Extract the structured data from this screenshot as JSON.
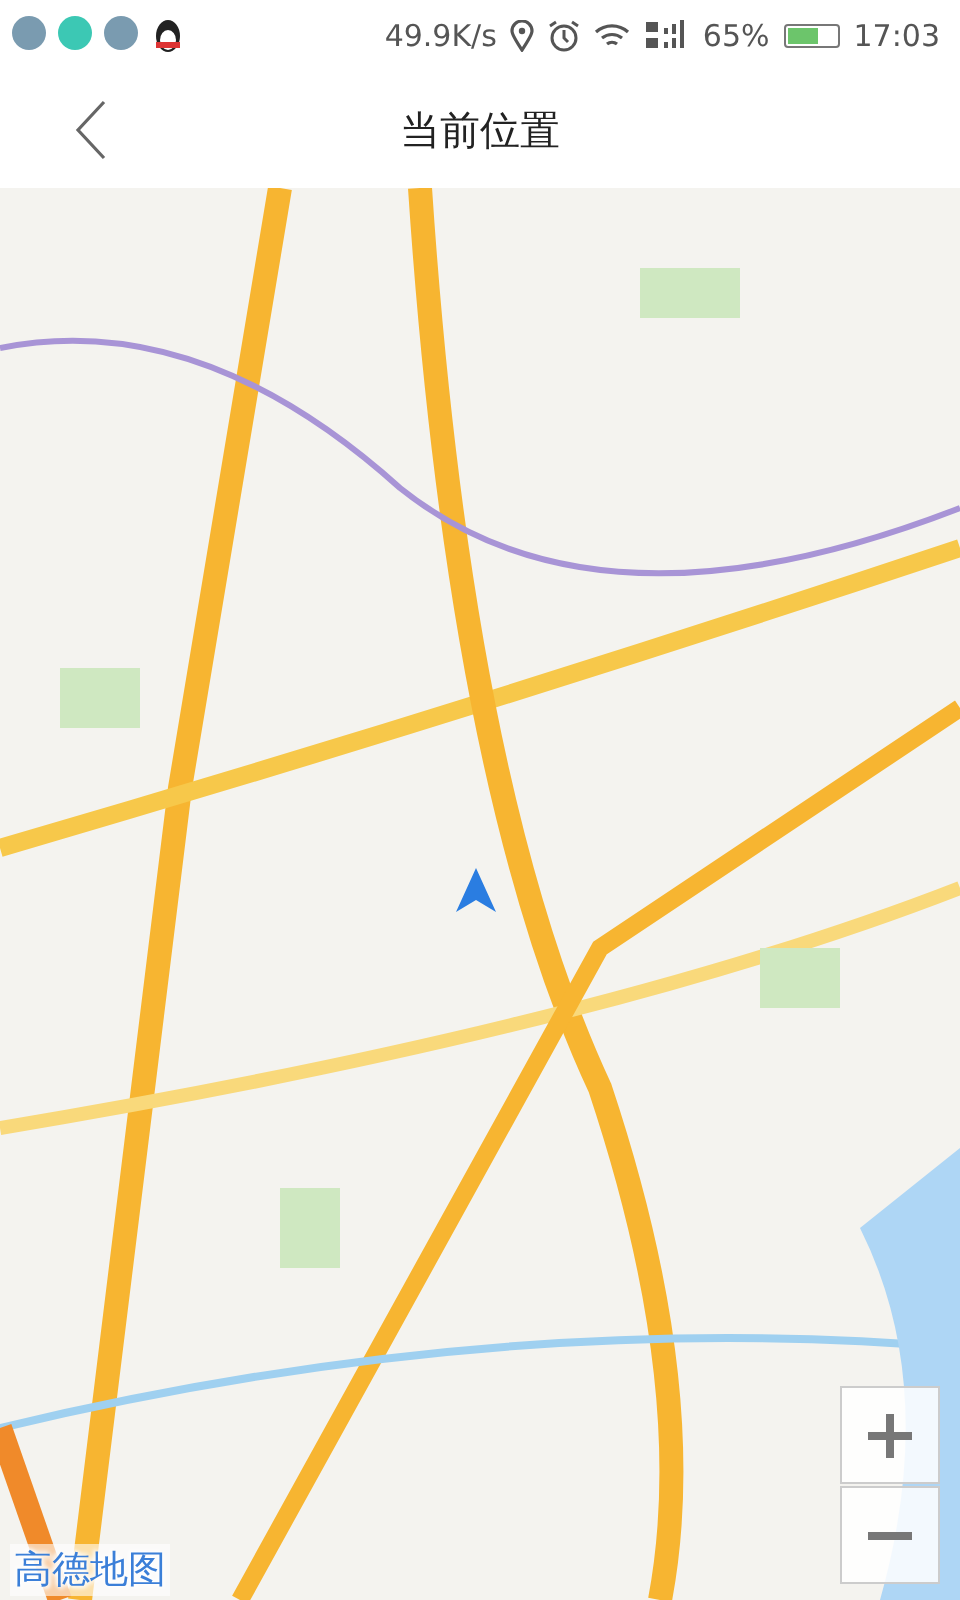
{
  "status_bar": {
    "net_speed": "49.9K/s",
    "battery_text": "65%",
    "battery": {
      "level": 0.65
    },
    "time": "17:03"
  },
  "header": {
    "title": "当前位置"
  },
  "map": {
    "kind": "picture",
    "logo": "高德地图"
  }
}
